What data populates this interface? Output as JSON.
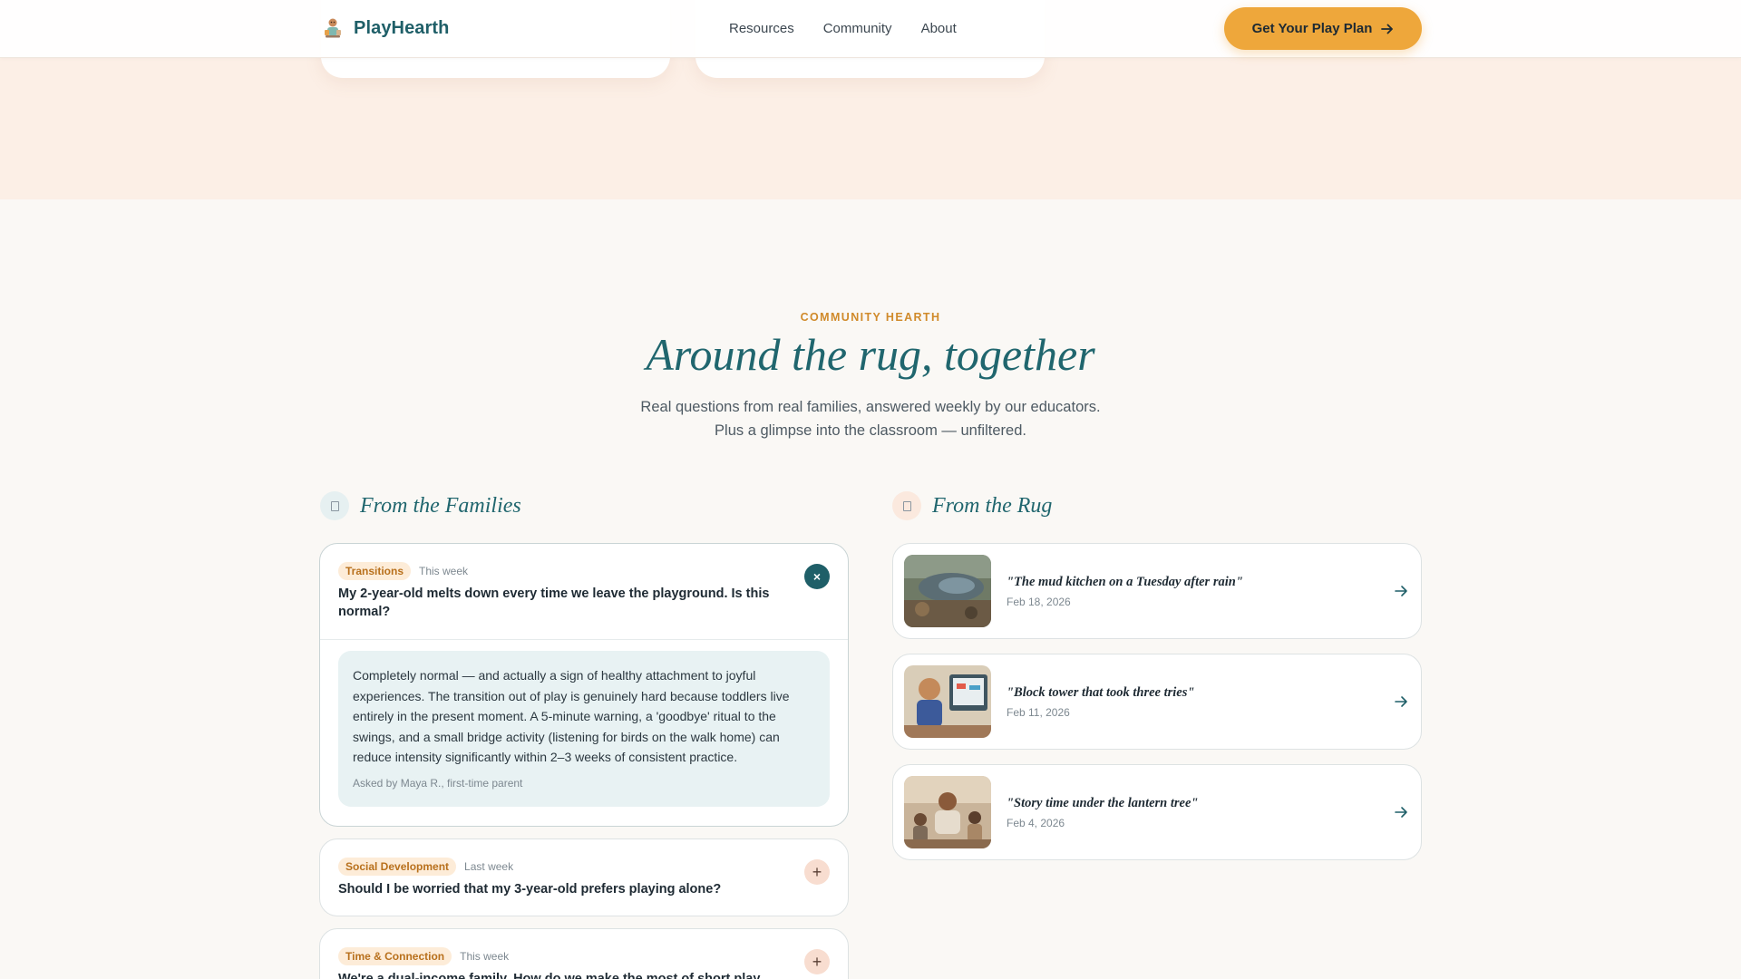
{
  "brand": {
    "name": "PlayHearth"
  },
  "nav": {
    "items": [
      "Resources",
      "Community",
      "About"
    ]
  },
  "cta": {
    "label": "Get Your Play Plan"
  },
  "section": {
    "eyebrow": "COMMUNITY HEARTH",
    "title": "Around the rug, together",
    "subtitle_line1": "Real questions from real families, answered weekly by our educators.",
    "subtitle_line2": "Plus a glimpse into the classroom — unfiltered."
  },
  "families": {
    "heading": "From the Families",
    "cards": [
      {
        "tag": "Transitions",
        "when": "This week",
        "question": "My 2-year-old melts down every time we leave the playground. Is this normal?",
        "expanded": true,
        "toggle": "×",
        "answer": "Completely normal — and actually a sign of healthy attachment to joyful experiences. The transition out of play is genuinely hard because toddlers live entirely in the present moment. A 5-minute warning, a 'goodbye' ritual to the swings, and a small bridge activity (listening for birds on the walk home) can reduce intensity significantly within 2–3 weeks of consistent practice.",
        "asked_by": "Asked by Maya R., first-time parent"
      },
      {
        "tag": "Social Development",
        "when": "Last week",
        "question": "Should I be worried that my 3-year-old prefers playing alone?",
        "expanded": false,
        "toggle": "+"
      },
      {
        "tag": "Time & Connection",
        "when": "This week",
        "question": "We're a dual-income family. How do we make the most of short play",
        "expanded": false,
        "toggle": "+"
      }
    ]
  },
  "rug": {
    "heading": "From the Rug",
    "cards": [
      {
        "title": "\"The mud kitchen on a Tuesday after rain\"",
        "date": "Feb 18, 2026",
        "image": "mud-kitchen-photo"
      },
      {
        "title": "\"Block tower that took three tries\"",
        "date": "Feb 11, 2026",
        "image": "block-tower-photo"
      },
      {
        "title": "\"Story time under the lantern tree\"",
        "date": "Feb 4, 2026",
        "image": "story-time-photo"
      }
    ]
  },
  "colors": {
    "brand_teal": "#1f5f68",
    "accent_orange": "#eea73b",
    "eyebrow": "#d08a2a",
    "peach_bg": "#fcefe6",
    "answer_bg": "#e8f2f3"
  }
}
